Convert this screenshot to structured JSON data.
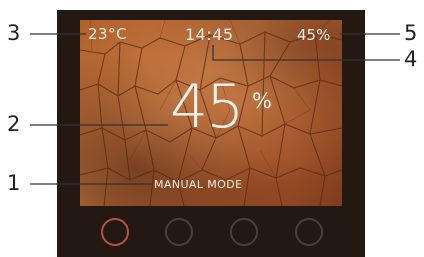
{
  "status_bar": {
    "temperature": "23°C",
    "time": "14:45",
    "humidity": "45%"
  },
  "main": {
    "value": "45",
    "unit": "%",
    "mode_label": "MANUAL MODE"
  },
  "buttons": [
    {
      "state": "active"
    },
    {
      "state": "inactive"
    },
    {
      "state": "inactive"
    },
    {
      "state": "inactive"
    }
  ],
  "callouts": {
    "n1": "1",
    "n2": "2",
    "n3": "3",
    "n4": "4",
    "n5": "5"
  },
  "colors": {
    "active_ring": "#b7523e",
    "inactive_ring": "#4a3f3a",
    "bezel": "#241813"
  }
}
